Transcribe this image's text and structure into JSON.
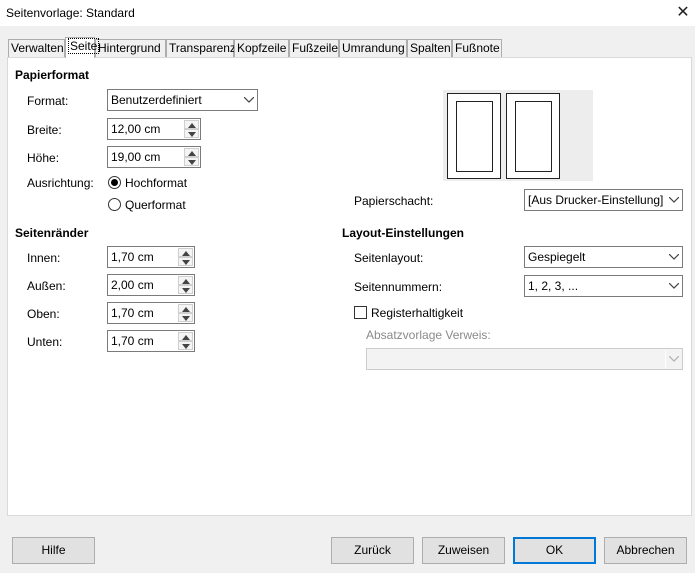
{
  "window": {
    "title": "Seitenvorlage: Standard",
    "close_symbol": "✕"
  },
  "tabs": [
    {
      "label": "Verwalten"
    },
    {
      "label": "Seite"
    },
    {
      "label": "Hintergrund"
    },
    {
      "label": "Transparenz"
    },
    {
      "label": "Kopfzeile"
    },
    {
      "label": "Fußzeile"
    },
    {
      "label": "Umrandung"
    },
    {
      "label": "Spalten"
    },
    {
      "label": "Fußnote"
    }
  ],
  "active_tab": "Seite",
  "paper_format": {
    "heading": "Papierformat",
    "format_label": "Format:",
    "format_value": "Benutzerdefiniert",
    "width_label": "Breite:",
    "width_value": "12,00 cm",
    "height_label": "Höhe:",
    "height_value": "19,00 cm",
    "orientation_label": "Ausrichtung:",
    "portrait_label": "Hochformat",
    "landscape_label": "Querformat",
    "selected_orientation": "Hochformat"
  },
  "paper_tray": {
    "label": "Papierschacht:",
    "value": "[Aus Drucker-Einstellung]"
  },
  "margins": {
    "heading": "Seitenränder",
    "inner_label": "Innen:",
    "inner_value": "1,70 cm",
    "outer_label": "Außen:",
    "outer_value": "2,00 cm",
    "top_label": "Oben:",
    "top_value": "1,70 cm",
    "bottom_label": "Unten:",
    "bottom_value": "1,70 cm"
  },
  "layout": {
    "heading": "Layout-Einstellungen",
    "page_layout_label": "Seitenlayout:",
    "page_layout_value": "Gespiegelt",
    "page_numbers_label": "Seitennummern:",
    "page_numbers_value": "1, 2, 3, ...",
    "register_label": "Registerhaltigkeit",
    "register_checked": false,
    "ref_style_label": "Absatzvorlage Verweis:",
    "ref_style_value": ""
  },
  "buttons": {
    "help": "Hilfe",
    "back": "Zurück",
    "reset": "Zuweisen",
    "ok": "OK",
    "cancel": "Abbrechen"
  }
}
